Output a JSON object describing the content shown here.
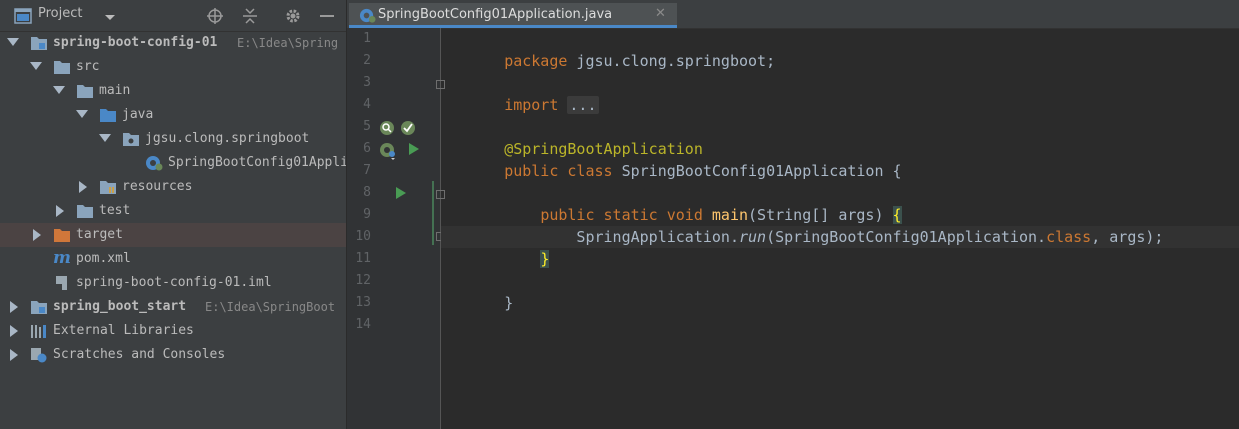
{
  "project_panel": {
    "title": "Project",
    "tree": [
      {
        "label": "spring-boot-config-01",
        "path": "E:\\Idea\\Spring"
      },
      {
        "label": "src"
      },
      {
        "label": "main"
      },
      {
        "label": "java"
      },
      {
        "label": "jgsu.clong.springboot"
      },
      {
        "label": "SpringBootConfig01Appli"
      },
      {
        "label": "resources"
      },
      {
        "label": "test"
      },
      {
        "label": "target"
      },
      {
        "label": "pom.xml"
      },
      {
        "label": "spring-boot-config-01.iml"
      },
      {
        "label": "spring_boot_start",
        "path": "E:\\Idea\\SpringBoot"
      },
      {
        "label": "External Libraries"
      },
      {
        "label": "Scratches and Consoles"
      }
    ]
  },
  "editor": {
    "tab_label": "SpringBootConfig01Application.java",
    "tab_close": "✕",
    "line_numbers": [
      "1",
      "2",
      "3",
      "4",
      "5",
      "6",
      "7",
      "8",
      "9",
      "10",
      "11",
      "12",
      "13",
      "14"
    ],
    "code": {
      "l1_kw": "package",
      "l1_rest": " jgsu.clong.springboot;",
      "l3_kw": "import",
      "l3_fold": "...",
      "l6_ann": "@SpringBootApplication",
      "l7_kw": "public class",
      "l7_rest": " SpringBootConfig01Application {",
      "l9_indent": "    ",
      "l9_kw": "public static void",
      "l9_fn": " main",
      "l9_rest": "(String[] args) ",
      "l9_brace": "{",
      "l10_a": "        SpringApplication.",
      "l10_run": "run",
      "l10_b": "(SpringBootConfig01Application.",
      "l10_kw": "class",
      "l10_c": ", args);",
      "l11_indent": "    ",
      "l11_brace": "}",
      "l13": "}"
    }
  },
  "colors": {
    "keyword": "#cc7832",
    "annotation": "#bbb529",
    "method": "#ffc66d",
    "text": "#a9b7c6",
    "folder": "#8aa4bc",
    "target_folder": "#d0773a",
    "selection": "#4b4343",
    "accent": "#4a88c7"
  }
}
